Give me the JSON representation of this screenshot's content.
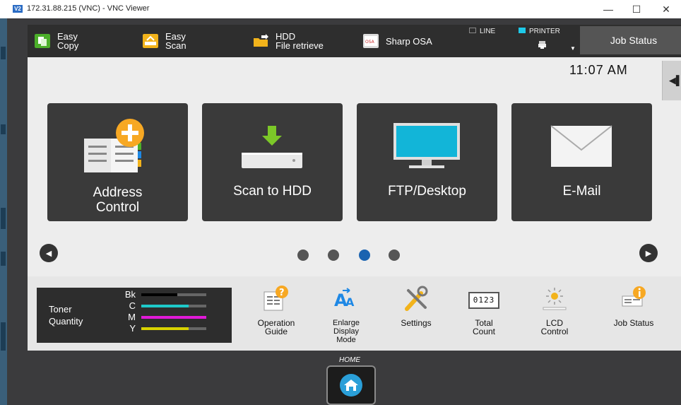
{
  "window": {
    "title": "172.31.88.215 (VNC) - VNC Viewer",
    "app_icon": "V2",
    "minimize": "—",
    "maximize": "☐",
    "close": "✕"
  },
  "topbar": {
    "easy_copy": "Easy\nCopy",
    "easy_scan": "Easy\nScan",
    "hdd_file_retrieve": "HDD\nFile retrieve",
    "sharp_osa": "Sharp OSA",
    "line_label": "LINE",
    "printer_label": "PRINTER",
    "job_status": "Job Status"
  },
  "main": {
    "clock": "11:07 AM",
    "tiles": [
      {
        "label": "Address\nControl"
      },
      {
        "label": "Scan to HDD"
      },
      {
        "label": "FTP/Desktop"
      },
      {
        "label": "E-Mail"
      }
    ],
    "page_dots": {
      "count": 4,
      "active": 3
    }
  },
  "bottom": {
    "toner": {
      "title": "Toner\nQuantity",
      "rows": [
        {
          "label": "Bk",
          "color": "#000000",
          "level": 0.55
        },
        {
          "label": "C",
          "color": "#1ec9c9",
          "level": 0.73
        },
        {
          "label": "M",
          "color": "#e01ad8",
          "level": 1.0
        },
        {
          "label": "Y",
          "color": "#d8d200",
          "level": 0.73
        }
      ]
    },
    "items": [
      {
        "label": "Operation\nGuide",
        "icon": "operation-guide-icon"
      },
      {
        "label": "Enlarge\nDisplay\nMode",
        "icon": "enlarge-display-icon"
      },
      {
        "label": "Settings",
        "icon": "settings-icon"
      },
      {
        "label": "Total\nCount",
        "icon": "total-count-icon",
        "counter": "0123"
      },
      {
        "label": "LCD\nControl",
        "icon": "lcd-control-icon"
      },
      {
        "label": "Job Status",
        "icon": "job-status-icon"
      }
    ]
  },
  "home": {
    "label": "HOME"
  },
  "colors": {
    "accent": "#1a63b0",
    "tile_bg": "#3a3a3a",
    "panel_bg": "#ededed"
  }
}
